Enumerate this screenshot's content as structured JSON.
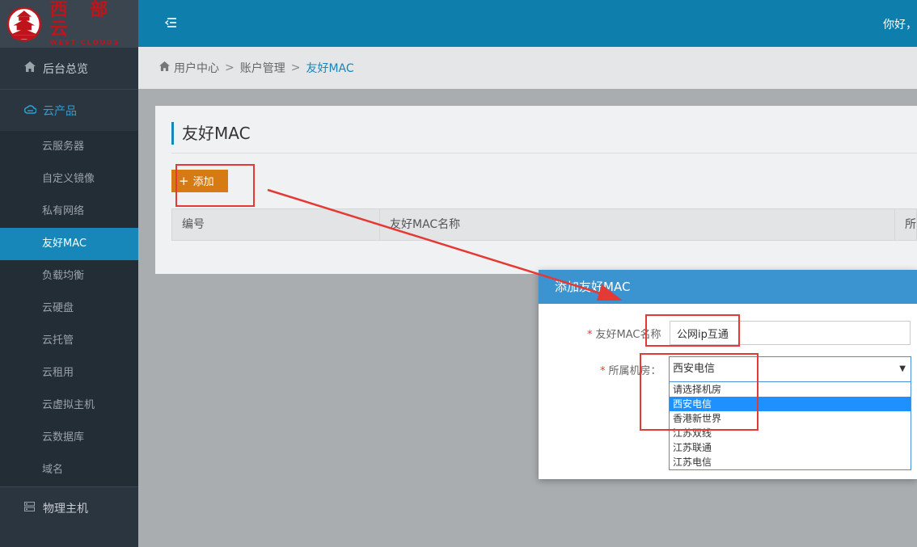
{
  "brand": {
    "name_cn": "西 部 云",
    "name_en": "WEST CLOUDS"
  },
  "header": {
    "greeting": "你好，"
  },
  "sidebar": {
    "dashboard": "后台总览",
    "cloud_products": "云产品",
    "items": [
      {
        "label": "云服务器"
      },
      {
        "label": "自定义镜像"
      },
      {
        "label": "私有网络"
      },
      {
        "label": "友好MAC"
      },
      {
        "label": "负载均衡"
      },
      {
        "label": "云硬盘"
      },
      {
        "label": "云托管"
      },
      {
        "label": "云租用"
      },
      {
        "label": "云虚拟主机"
      },
      {
        "label": "云数据库"
      },
      {
        "label": "域名"
      }
    ],
    "physical_host": "物理主机"
  },
  "breadcrumb": {
    "items": [
      "用户中心",
      "账户管理",
      "友好MAC"
    ],
    "separator": ">"
  },
  "panel": {
    "title": "友好MAC",
    "add_button": "添加",
    "columns": [
      "编号",
      "友好MAC名称",
      "所"
    ]
  },
  "modal": {
    "title": "添加友好MAC",
    "name_label": "友好MAC名称",
    "name_value": "公网ip互通",
    "room_label": "所属机房：",
    "room_selected": "西安电信",
    "room_options": [
      "请选择机房",
      "西安电信",
      "香港新世界",
      "江苏双线",
      "江苏联通",
      "江苏电信"
    ],
    "required_mark": "*"
  },
  "colors": {
    "header": "#0e7fad",
    "sidebar": "#2a3540",
    "active_item": "#1687b8",
    "add_button": "#d67a14",
    "annotation": "#e53935"
  },
  "icons": {
    "dashboard": "home-icon",
    "cloud": "cloud-icon",
    "physical": "server-icon",
    "toggle": "menu-toggle-icon"
  }
}
